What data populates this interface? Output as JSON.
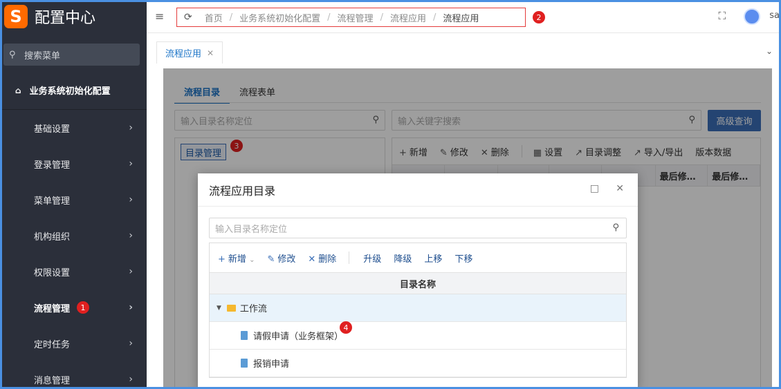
{
  "sidebar": {
    "logo_letter": "S",
    "app_title": "配置中心",
    "search_placeholder": "搜索菜单",
    "root_item": "业务系统初始化配置",
    "items": [
      {
        "label": "基础设置"
      },
      {
        "label": "登录管理"
      },
      {
        "label": "菜单管理"
      },
      {
        "label": "机构组织"
      },
      {
        "label": "权限设置"
      },
      {
        "label": "流程管理",
        "badge": "1"
      },
      {
        "label": "定时任务"
      },
      {
        "label": "消息管理"
      }
    ]
  },
  "header": {
    "breadcrumb": [
      "首页",
      "业务系统初始化配置",
      "流程管理",
      "流程应用",
      "流程应用"
    ],
    "breadcrumb_badge": "2",
    "user": "sa"
  },
  "tabs": {
    "open_tab": "流程应用"
  },
  "page": {
    "subtabs": [
      "流程目录",
      "流程表单"
    ],
    "left_search_placeholder": "输入目录名称定位",
    "right_search_placeholder": "输入关键字搜索",
    "advanced_search": "高级查询",
    "dir_manage_button": "目录管理",
    "dir_manage_badge": "3",
    "toolbar": [
      "新增",
      "修改",
      "删除",
      "设置",
      "目录调整",
      "导入/导出",
      "版本数据"
    ],
    "columns_visible": [
      "最后修…",
      "最后修…"
    ]
  },
  "modal": {
    "title": "流程应用目录",
    "search_placeholder": "输入目录名称定位",
    "toolbar": [
      "新增",
      "修改",
      "删除",
      "升级",
      "降级",
      "上移",
      "下移"
    ],
    "column_header": "目录名称",
    "rows": [
      {
        "label": "工作流",
        "type": "folder"
      },
      {
        "label": "请假申请（业务框架）",
        "type": "doc",
        "badge": "4"
      },
      {
        "label": "报销申请",
        "type": "doc"
      }
    ]
  }
}
